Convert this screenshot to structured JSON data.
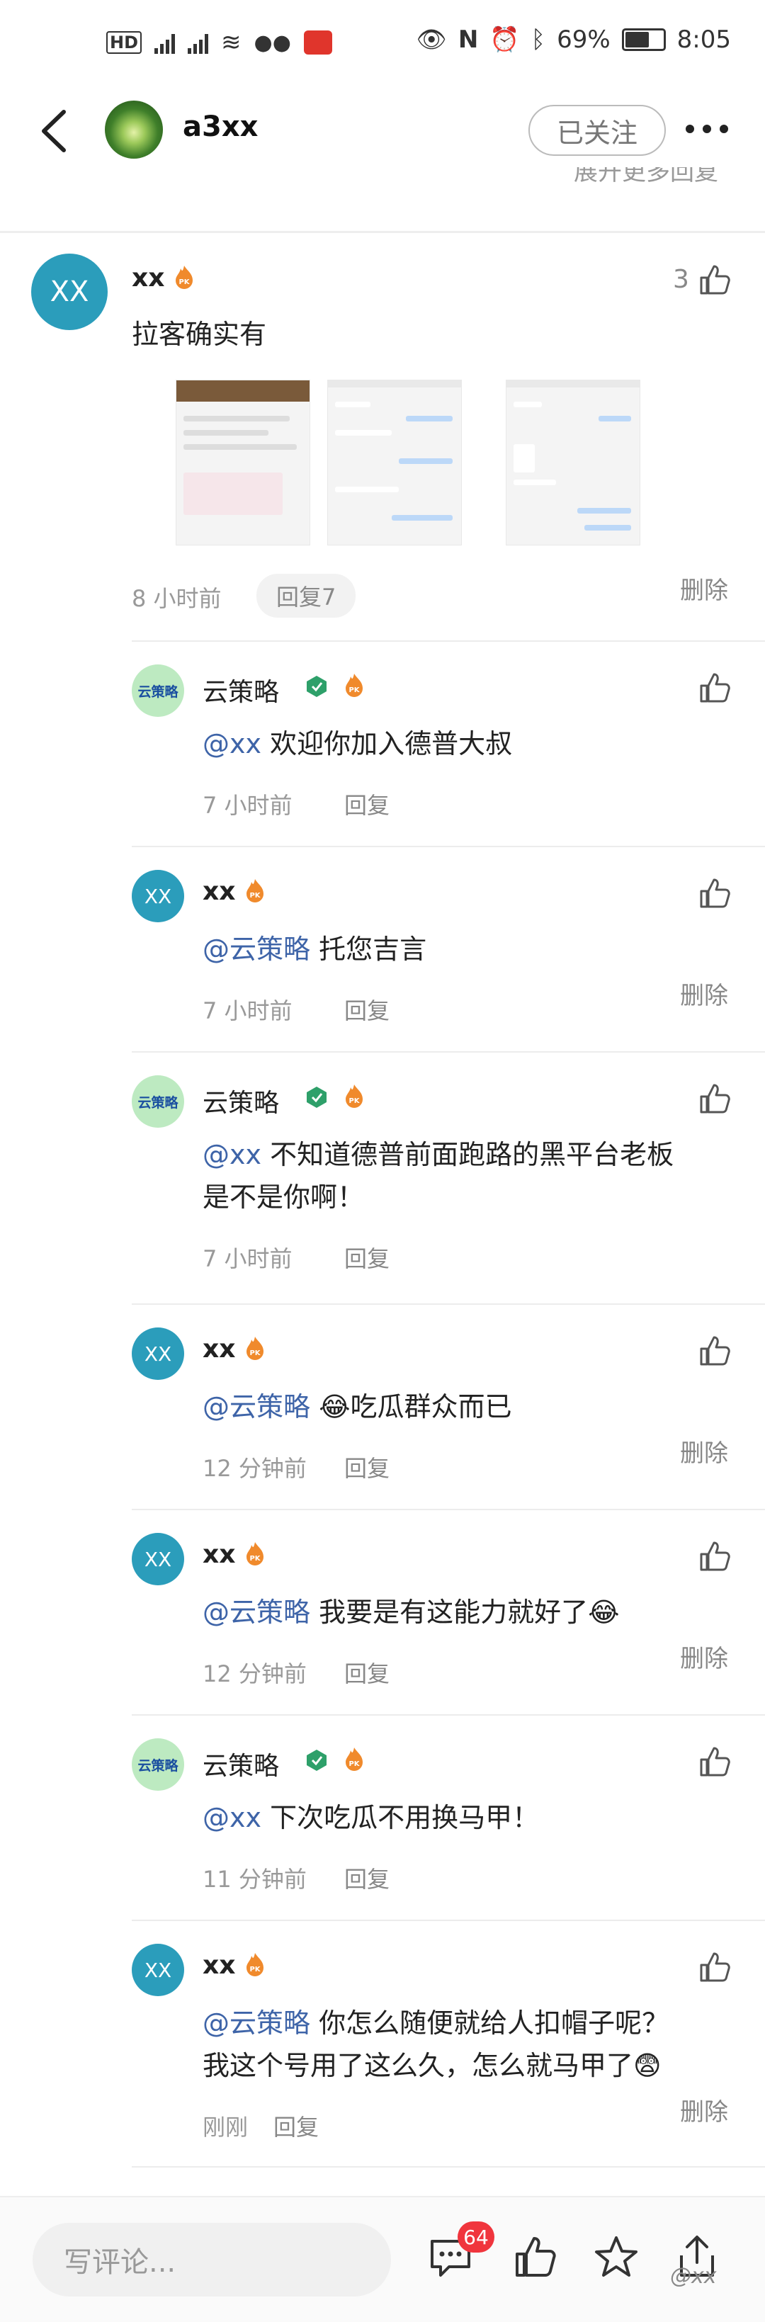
{
  "status_bar": {
    "left_icons": [
      "HD2",
      "4G",
      "4G",
      "wifi",
      "wechat",
      "app"
    ],
    "battery": "69%",
    "battery_level": 0.69,
    "time": "8:05"
  },
  "header": {
    "username": "a3xx",
    "follow_label": "已关注",
    "cutoff_text": "展开更多回复"
  },
  "main_comment": {
    "avatar_text": "XX",
    "username": "xx",
    "like_count": "3",
    "text": "拉客确实有",
    "time": "8 小时前",
    "reply_label": "回复7",
    "delete_label": "删除"
  },
  "replies": [
    {
      "avatar": "云策略",
      "username": "云策略",
      "at": "@xx",
      "text": " 欢迎你加入德普大叔",
      "time": "7 小时前",
      "reply": "回复",
      "delete": ""
    },
    {
      "avatar": "XX",
      "username": "xx",
      "at": "@云策略",
      "text": " 托您吉言",
      "time": "7 小时前",
      "reply": "回复",
      "delete": "删除"
    },
    {
      "avatar": "云策略",
      "username": "云策略",
      "at": "@xx",
      "text": " 不知道德普前面跑路的黑平台老板",
      "text2": "是不是你啊！",
      "time": "7 小时前",
      "reply": "回复",
      "delete": ""
    },
    {
      "avatar": "XX",
      "username": "xx",
      "at": "@云策略",
      "text": " 😂吃瓜群众而已",
      "time": "12 分钟前",
      "reply": "回复",
      "delete": "删除"
    },
    {
      "avatar": "XX",
      "username": "xx",
      "at": "@云策略",
      "text": " 我要是有这能力就好了😂",
      "time": "12 分钟前",
      "reply": "回复",
      "delete": "删除"
    },
    {
      "avatar": "云策略",
      "username": "云策略",
      "at": "@xx",
      "text": " 下次吃瓜不用换马甲！",
      "time": "11 分钟前",
      "reply": "回复",
      "delete": ""
    },
    {
      "avatar": "XX",
      "username": "xx",
      "at": "@云策略",
      "text": " 你怎么随便就给人扣帽子呢？",
      "text2": "我这个号用了这么久，怎么就马甲了😨",
      "time": "刚刚",
      "reply": "回复",
      "delete": "删除"
    }
  ],
  "bottom_bar": {
    "placeholder": "写评论...",
    "comment_count": "64",
    "watermark": "@xx"
  }
}
